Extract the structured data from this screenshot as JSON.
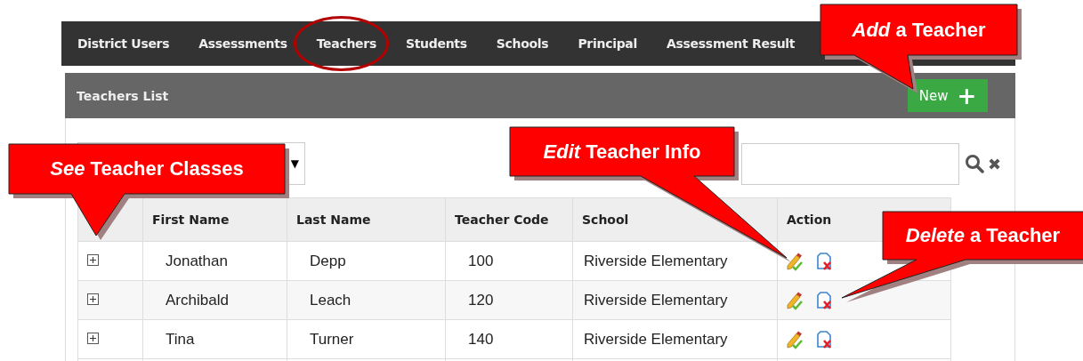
{
  "nav": {
    "tabs": [
      {
        "label": "District Users",
        "circled": false
      },
      {
        "label": "Assessments",
        "circled": false
      },
      {
        "label": "Teachers",
        "circled": true
      },
      {
        "label": "Students",
        "circled": false
      },
      {
        "label": "Schools",
        "circled": false
      },
      {
        "label": "Principal",
        "circled": false
      },
      {
        "label": "Assessment Result",
        "circled": false
      }
    ]
  },
  "panel": {
    "title": "Teachers List",
    "new_button": {
      "label": "New",
      "icon": "+"
    }
  },
  "filter": {
    "dropdown_caret": "▼"
  },
  "search": {
    "clear_icon": "✖"
  },
  "table": {
    "columns": [
      "First Name",
      "Last Name",
      "Teacher Code",
      "School",
      "Action"
    ],
    "rows": [
      {
        "first_name": "Jonathan",
        "last_name": "Depp",
        "teacher_code": "100",
        "school": "Riverside Elementary"
      },
      {
        "first_name": "Archibald",
        "last_name": "Leach",
        "teacher_code": "120",
        "school": "Riverside Elementary"
      },
      {
        "first_name": "Tina",
        "last_name": "Turner",
        "teacher_code": "140",
        "school": "Riverside Elementary"
      }
    ]
  },
  "callouts": [
    {
      "text": "*Add* a Teacher"
    },
    {
      "text": "*See* Teacher Classes"
    },
    {
      "text": "*Edit* Teacher Info"
    },
    {
      "text": "*Delete* a Teacher"
    }
  ]
}
